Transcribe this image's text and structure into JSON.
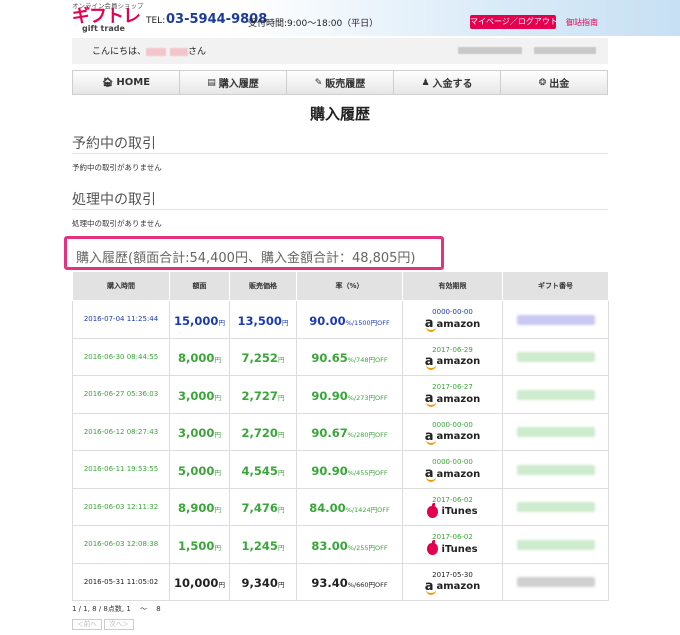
{
  "header": {
    "logo_sub": "オンライン会員ショップ",
    "logo_main": "ギフトレ",
    "logo_en": "gift trade",
    "tel_label": "TEL:",
    "tel_number": "03-5944-9808",
    "hours": "受付時間:9:00〜18:00（平日）",
    "mypage_button": "マイページ／ログアウト",
    "guide_link": "御站指南"
  },
  "greeting": {
    "prefix": "こんにちは、",
    "suffix": "さん"
  },
  "nav": [
    {
      "icon": "home-icon",
      "glyph": "🏠︎",
      "label": "HOME"
    },
    {
      "icon": "list-icon",
      "glyph": "▤",
      "label": "購入履歴"
    },
    {
      "icon": "edit-icon",
      "glyph": "✎",
      "label": "販売履歴"
    },
    {
      "icon": "moneybag-icon",
      "glyph": "♟",
      "label": "入金する"
    },
    {
      "icon": "coin-icon",
      "glyph": "❂",
      "label": "出金"
    }
  ],
  "page_title": "購入履歴",
  "sections": {
    "reserved": {
      "title": "予約中の取引",
      "note": "予約中の取引がありません"
    },
    "processing": {
      "title": "処理中の取引",
      "note": "処理中の取引がありません"
    },
    "history_title": "購入履歴(額面合計:54,400円、購入金額合計：48,805円)"
  },
  "table": {
    "headers": [
      "購入時間",
      "額面",
      "販売価格",
      "率（%）",
      "有効期限",
      "ギフト番号"
    ],
    "yen": "円",
    "rows": [
      {
        "date": "2016-07-04 11:25:44",
        "face": "15,000",
        "price": "13,500",
        "rate": "90.00",
        "rate_sub": "%/1500円OFF",
        "expiry": "0000-00-00",
        "brand": "amazon",
        "color": "blue"
      },
      {
        "date": "2016-06-30 08:44:55",
        "face": "8,000",
        "price": "7,252",
        "rate": "90.65",
        "rate_sub": "%/748円OFF",
        "expiry": "2017-06-29",
        "brand": "amazon",
        "color": "green"
      },
      {
        "date": "2016-06-27 05:36:03",
        "face": "3,000",
        "price": "2,727",
        "rate": "90.90",
        "rate_sub": "%/273円OFF",
        "expiry": "2017-06-27",
        "brand": "amazon",
        "color": "green"
      },
      {
        "date": "2016-06-12 08:27:43",
        "face": "3,000",
        "price": "2,720",
        "rate": "90.67",
        "rate_sub": "%/280円OFF",
        "expiry": "0000-00-00",
        "brand": "amazon",
        "color": "green"
      },
      {
        "date": "2016-06-11 19:53:55",
        "face": "5,000",
        "price": "4,545",
        "rate": "90.90",
        "rate_sub": "%/455円OFF",
        "expiry": "0000-00-00",
        "brand": "amazon",
        "color": "green"
      },
      {
        "date": "2016-06-03 12:11:32",
        "face": "8,900",
        "price": "7,476",
        "rate": "84.00",
        "rate_sub": "%/1424円OFF",
        "expiry": "2017-06-02",
        "brand": "iTunes",
        "color": "green"
      },
      {
        "date": "2016-06-03 12:08:38",
        "face": "1,500",
        "price": "1,245",
        "rate": "83.00",
        "rate_sub": "%/255円OFF",
        "expiry": "2017-06-02",
        "brand": "iTunes",
        "color": "green"
      },
      {
        "date": "2016-05-31 11:05:02",
        "face": "10,000",
        "price": "9,340",
        "rate": "93.40",
        "rate_sub": "%/660円OFF",
        "expiry": "2017-05-30",
        "brand": "amazon",
        "color": "dark"
      }
    ]
  },
  "pager": {
    "info": "1 / 1, 8 / 8点数, 1 　〜　 8",
    "prev": "＜前へ",
    "next": "次へ＞"
  },
  "colors": {
    "accent": "#e5004f",
    "blue": "#1b3bb5",
    "green": "#3aa63a",
    "highlight": "#e5327e"
  }
}
